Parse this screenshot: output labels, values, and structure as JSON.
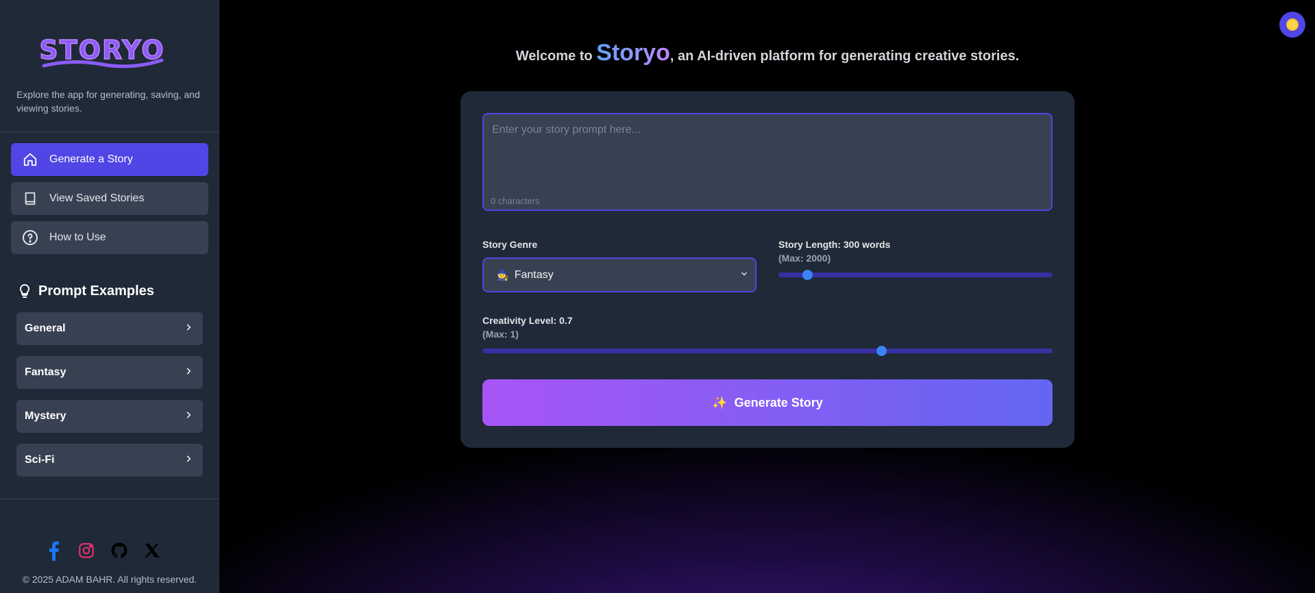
{
  "sidebar": {
    "logo_text": "STORYO",
    "tagline": "Explore the app for generating, saving, and viewing stories.",
    "nav": [
      {
        "label": "Generate a Story",
        "icon": "home-icon",
        "active": true
      },
      {
        "label": "View Saved Stories",
        "icon": "book-icon",
        "active": false
      },
      {
        "label": "How to Use",
        "icon": "help-circle-icon",
        "active": false
      }
    ],
    "examples_title": "Prompt Examples",
    "examples": [
      {
        "label": "General"
      },
      {
        "label": "Fantasy"
      },
      {
        "label": "Mystery"
      },
      {
        "label": "Sci-Fi"
      }
    ],
    "socials": [
      "facebook-icon",
      "instagram-icon",
      "github-icon",
      "x-icon"
    ],
    "copyright": "© 2025 ADAM BAHR. All rights reserved."
  },
  "header": {
    "welcome_prefix": "Welcome to ",
    "brand": "Storyo",
    "welcome_suffix": ", an AI-driven platform for generating creative stories."
  },
  "form": {
    "prompt_placeholder": "Enter your story prompt here...",
    "prompt_value": "",
    "char_count": "0 characters",
    "genre_label": "Story Genre",
    "genre_emoji": "🧙",
    "genre_value": "Fantasy",
    "length_label": "Story Length: 300 words",
    "length_max": "(Max: 2000)",
    "length_value": 300,
    "length_min": 100,
    "length_max_value": 2000,
    "creativity_label": "Creativity Level: 0.7",
    "creativity_max": "(Max: 1)",
    "creativity_value": 0.7,
    "creativity_min": 0,
    "creativity_max_value": 1,
    "generate_label": "Generate Story",
    "generate_icon": "sparkles-icon"
  },
  "theme_toggle": {
    "icon": "sun-icon"
  },
  "colors": {
    "accent": "#4f46e5",
    "sidebar_bg": "#1f2937",
    "card_bg": "#1f2937",
    "button_gradient_start": "#a855f7",
    "button_gradient_end": "#6366f1",
    "slider_thumb": "#3b82f6"
  }
}
